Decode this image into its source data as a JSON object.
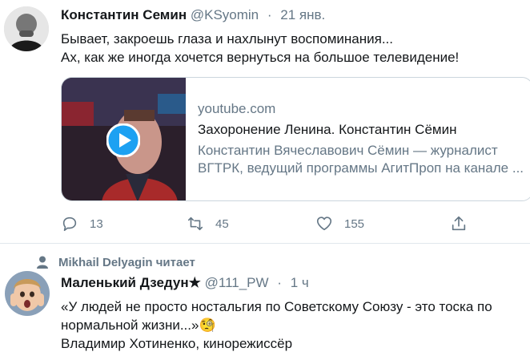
{
  "tweet1": {
    "name": "Константин Семин",
    "handle": "@KSyomin",
    "dot": "·",
    "time": "21 янв.",
    "text_line1": "Бывает, закроешь глаза и нахлынут воспоминания...",
    "text_line2": "Ах, как же иногда хочется вернуться на большое телевидение!",
    "card": {
      "domain": "youtube.com",
      "title": "Захоронение Ленина. Константин Сёмин",
      "description": "Константин Вячеславович Сёмин — журналист ВГТРК, ведущий программы АгитПроп на канале ..."
    },
    "actions": {
      "reply_count": "13",
      "retweet_count": "45",
      "like_count": "155"
    },
    "colors": {
      "play_button": "#1da1f2",
      "muted_text": "#657786"
    }
  },
  "tweet2": {
    "context": "Mikhail Delyagin читает",
    "name": "Маленький Дзедун★",
    "handle": "@111_PW",
    "dot": "·",
    "time": "1 ч",
    "line1": "«У людей не просто ностальгия по Советскому Союзу - это тоска по",
    "line2": "нормальной жизни...»🧐",
    "line3": "Владимир Хотиненко, кинорежиссёр"
  }
}
